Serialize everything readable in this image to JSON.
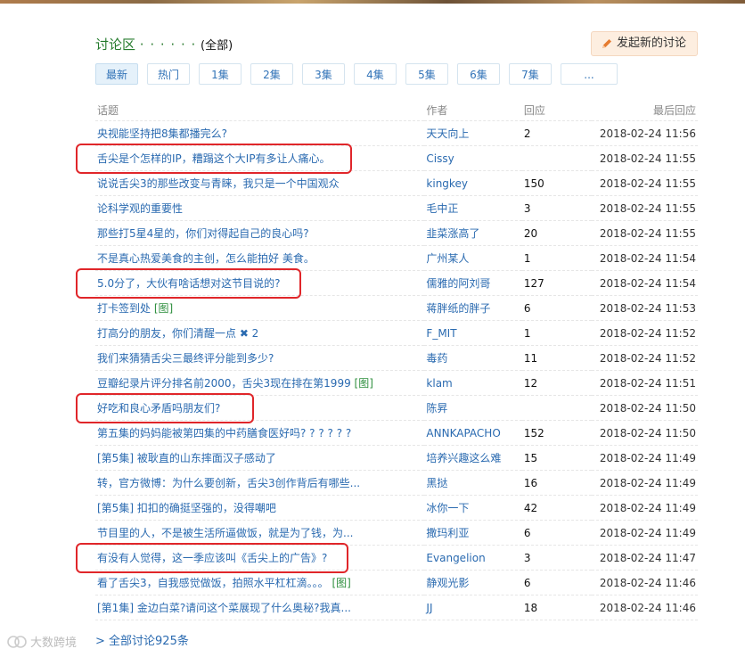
{
  "header": {
    "title": "讨论区",
    "dots": "· · · · · ·",
    "all_label": "(全部)",
    "new_discussion_label": "发起新的讨论"
  },
  "tabs": [
    {
      "label": "最新",
      "active": true
    },
    {
      "label": "热门",
      "active": false
    },
    {
      "label": "1集",
      "active": false
    },
    {
      "label": "2集",
      "active": false
    },
    {
      "label": "3集",
      "active": false
    },
    {
      "label": "4集",
      "active": false
    },
    {
      "label": "5集",
      "active": false
    },
    {
      "label": "6集",
      "active": false
    },
    {
      "label": "7集",
      "active": false
    },
    {
      "label": "...",
      "active": false
    }
  ],
  "columns": {
    "topic": "话题",
    "author": "作者",
    "replies": "回应",
    "last_reply": "最后回应"
  },
  "rows": [
    {
      "topic": "央视能坚持把8集都播完么?",
      "pic": "",
      "author": "天天向上",
      "replies": "2",
      "time": "2018-02-24 11:56",
      "highlight": false
    },
    {
      "topic": "舌尖是个怎样的IP，糟蹋这个大IP有多让人痛心。",
      "pic": "",
      "author": "Cissy",
      "replies": "",
      "time": "2018-02-24 11:55",
      "highlight": true
    },
    {
      "topic": "说说舌尖3的那些改变与青睐，我只是一个中国观众",
      "pic": "",
      "author": "kingkey",
      "replies": "150",
      "time": "2018-02-24 11:55",
      "highlight": false
    },
    {
      "topic": "论科学观的重要性",
      "pic": "",
      "author": "毛中正",
      "replies": "3",
      "time": "2018-02-24 11:55",
      "highlight": false
    },
    {
      "topic": "那些打5星4星的，你们对得起自己的良心吗?",
      "pic": "",
      "author": "韭菜涨高了",
      "replies": "20",
      "time": "2018-02-24 11:55",
      "highlight": false
    },
    {
      "topic": "不是真心热爱美食的主创，怎么能拍好 美食。",
      "pic": "",
      "author": "广州某人",
      "replies": "1",
      "time": "2018-02-24 11:54",
      "highlight": false
    },
    {
      "topic": "5.0分了，大伙有啥话想对这节目说的?",
      "pic": "",
      "author": "儒雅的阿刘哥",
      "replies": "127",
      "time": "2018-02-24 11:54",
      "highlight": true
    },
    {
      "topic": "打卡签到处",
      "pic": "[图]",
      "author": "蒋胖纸的胖子",
      "replies": "6",
      "time": "2018-02-24 11:53",
      "highlight": false
    },
    {
      "topic": "打高分的朋友，你们清醒一点 ✖ 2",
      "pic": "",
      "author": "F_MIT",
      "replies": "1",
      "time": "2018-02-24 11:52",
      "highlight": false
    },
    {
      "topic": "我们来猜猜舌尖三最终评分能到多少?",
      "pic": "",
      "author": "毒药",
      "replies": "11",
      "time": "2018-02-24 11:52",
      "highlight": false
    },
    {
      "topic": "豆瓣纪录片评分排名前2000，舌尖3现在排在第1999",
      "pic": "[图]",
      "author": "klam",
      "replies": "12",
      "time": "2018-02-24 11:51",
      "highlight": false
    },
    {
      "topic": "好吃和良心矛盾吗朋友们?",
      "pic": "",
      "author": "陈昇",
      "replies": "",
      "time": "2018-02-24 11:50",
      "highlight": true
    },
    {
      "topic": "第五集的妈妈能被第四集的中药膳食医好吗? ? ? ? ? ?",
      "pic": "",
      "author": "ANNKAPACHO",
      "replies": "152",
      "time": "2018-02-24 11:50",
      "highlight": false
    },
    {
      "topic": "[第5集] 被耿直的山东摔面汉子感动了",
      "pic": "",
      "author": "培养兴趣这么难",
      "replies": "15",
      "time": "2018-02-24 11:49",
      "highlight": false
    },
    {
      "topic": "转，官方微博：为什么要创新，舌尖3创作背后有哪些...",
      "pic": "",
      "author": "黑挞",
      "replies": "16",
      "time": "2018-02-24 11:49",
      "highlight": false
    },
    {
      "topic": "[第5集] 扣扣的确挺坚强的，没得嘲吧",
      "pic": "",
      "author": "冰你一下",
      "replies": "42",
      "time": "2018-02-24 11:49",
      "highlight": false
    },
    {
      "topic": "节目里的人，不是被生活所逼做饭，就是为了钱，为...",
      "pic": "",
      "author": "撒玛利亚",
      "replies": "6",
      "time": "2018-02-24 11:49",
      "highlight": false
    },
    {
      "topic": "有没有人觉得，这一季应该叫《舌尖上的广告》?",
      "pic": "",
      "author": "Evangelion",
      "replies": "3",
      "time": "2018-02-24 11:47",
      "highlight": true
    },
    {
      "topic": "看了舌尖3，自我感觉做饭，拍照水平杠杠滴。。。",
      "pic": "[图]",
      "author": "静观光影",
      "replies": "6",
      "time": "2018-02-24 11:46",
      "highlight": false
    },
    {
      "topic": "[第1集] 金边白菜?请问这个菜展现了什么奥秘?我真...",
      "pic": "",
      "author": "JJ",
      "replies": "18",
      "time": "2018-02-24 11:46",
      "highlight": false
    }
  ],
  "footer": {
    "all_discussions_label": "> 全部讨论925条"
  },
  "watermark": {
    "text": "大数跨境"
  },
  "colors": {
    "link": "#2a6ab0",
    "title_green": "#2e7d32",
    "highlight_red": "#e0262a",
    "new_button_bg": "#fdeee0"
  }
}
